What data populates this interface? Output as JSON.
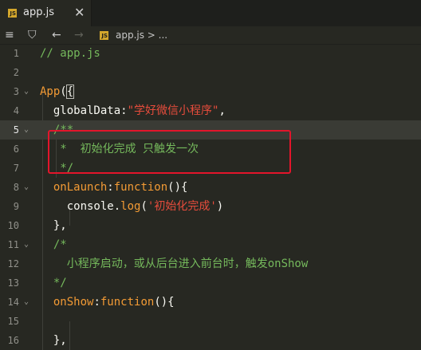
{
  "tab": {
    "file_badge": "JS",
    "title": "app.js",
    "close": "✕"
  },
  "toolbar": {
    "list_icon": "≡",
    "bookmark_icon": "⛉",
    "back_icon": "←",
    "forward_icon": "→",
    "file_badge": "JS",
    "breadcrumb": "app.js > ..."
  },
  "editor": {
    "lines": [
      {
        "num": "1",
        "tokens": [
          {
            "cls": "comment",
            "text": "// app.js"
          }
        ]
      },
      {
        "num": "2",
        "tokens": []
      },
      {
        "num": "3",
        "fold": "⌄",
        "tokens": [
          {
            "cls": "fn",
            "text": "App"
          },
          {
            "cls": "punc",
            "text": "("
          },
          {
            "cls": "punc brace",
            "text": "{"
          }
        ]
      },
      {
        "num": "4",
        "tokens": [
          {
            "cls": "punc",
            "text": "  globalData:"
          },
          {
            "cls": "str",
            "text": "\"学好微信小程序\""
          },
          {
            "cls": "punc",
            "text": ","
          }
        ]
      },
      {
        "num": "5",
        "active": true,
        "fold": "⌄",
        "tokens": [
          {
            "cls": "comment",
            "text": "  /**"
          }
        ]
      },
      {
        "num": "6",
        "tokens": [
          {
            "cls": "comment",
            "text": "   *  初始化完成 只触发一次"
          }
        ]
      },
      {
        "num": "7",
        "tokens": [
          {
            "cls": "comment",
            "text": "   */"
          }
        ]
      },
      {
        "num": "8",
        "fold": "⌄",
        "tokens": [
          {
            "cls": "kw",
            "text": "  onLaunch"
          },
          {
            "cls": "punc",
            "text": ":"
          },
          {
            "cls": "kw",
            "text": "function"
          },
          {
            "cls": "punc",
            "text": "(){"
          }
        ]
      },
      {
        "num": "9",
        "tokens": [
          {
            "cls": "punc",
            "text": "    console."
          },
          {
            "cls": "kw",
            "text": "log"
          },
          {
            "cls": "punc",
            "text": "("
          },
          {
            "cls": "str",
            "text": "'初始化完成'"
          },
          {
            "cls": "punc",
            "text": ")"
          }
        ]
      },
      {
        "num": "10",
        "tokens": [
          {
            "cls": "punc",
            "text": "  },"
          }
        ]
      },
      {
        "num": "11",
        "fold": "⌄",
        "tokens": [
          {
            "cls": "comment",
            "text": "  /*"
          }
        ]
      },
      {
        "num": "12",
        "tokens": [
          {
            "cls": "comment",
            "text": "    小程序启动，或从后台进入前台时，触发onShow"
          }
        ]
      },
      {
        "num": "13",
        "tokens": [
          {
            "cls": "comment",
            "text": "  */"
          }
        ]
      },
      {
        "num": "14",
        "fold": "⌄",
        "tokens": [
          {
            "cls": "kw",
            "text": "  onShow"
          },
          {
            "cls": "punc",
            "text": ":"
          },
          {
            "cls": "kw",
            "text": "function"
          },
          {
            "cls": "punc",
            "text": "(){"
          }
        ]
      },
      {
        "num": "15",
        "tokens": []
      },
      {
        "num": "16",
        "tokens": [
          {
            "cls": "punc",
            "text": "  },"
          }
        ]
      }
    ]
  },
  "colors": {
    "background": "#272822",
    "comment": "#75b95c",
    "keyword": "#f39b35",
    "string": "#e74c3c",
    "highlight_box": "#e3152b"
  }
}
